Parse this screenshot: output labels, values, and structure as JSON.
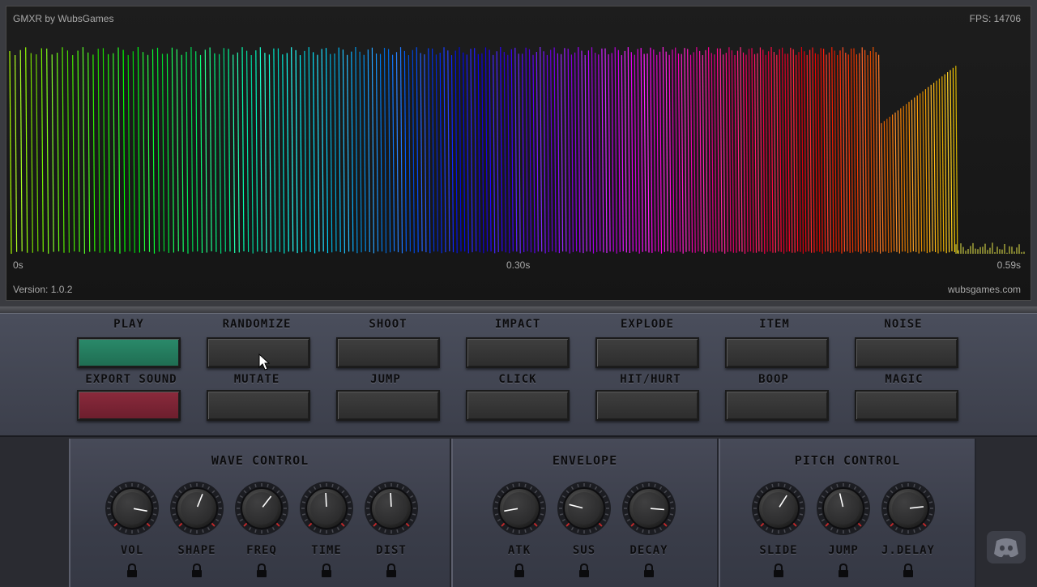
{
  "waveform": {
    "app_title": "GMXR by WubsGames",
    "fps": "FPS: 14706",
    "time_start": "0s",
    "time_mid": "0.30s",
    "time_end": "0.59s",
    "version": "Version: 1.0.2",
    "site": "wubsgames.com"
  },
  "presets": {
    "row1": [
      "Play",
      "Randomize",
      "Shoot",
      "Impact",
      "Explode",
      "Item",
      "Noise"
    ],
    "row2": [
      "Export Sound",
      "Mutate",
      "Jump",
      "Click",
      "Hit/Hurt",
      "Boop",
      "Magic"
    ]
  },
  "panels": {
    "wave_control": {
      "title": "Wave Control",
      "knobs": [
        {
          "label": "Vol",
          "value": 0.87
        },
        {
          "label": "Shape",
          "value": 0.58
        },
        {
          "label": "Freq",
          "value": 0.64
        },
        {
          "label": "Time",
          "value": 0.49
        },
        {
          "label": "Dist",
          "value": 0.49
        }
      ]
    },
    "envelope": {
      "title": "Envelope",
      "knobs": [
        {
          "label": "Atk",
          "value": 0.13
        },
        {
          "label": "Sus",
          "value": 0.22
        },
        {
          "label": "Decay",
          "value": 0.85
        }
      ]
    },
    "pitch_control": {
      "title": "Pitch Control",
      "knobs": [
        {
          "label": "Slide",
          "value": 0.62
        },
        {
          "label": "Jump",
          "value": 0.45
        },
        {
          "label": "J.Delay",
          "value": 0.81
        }
      ]
    }
  },
  "colors": {
    "play_button": "#1f6d52",
    "export_button": "#6c1e2d",
    "knob_indicator": "#ffffff"
  },
  "icons": {
    "lock": "lock-icon",
    "discord": "discord-icon",
    "cursor": "mouse-cursor-icon"
  }
}
